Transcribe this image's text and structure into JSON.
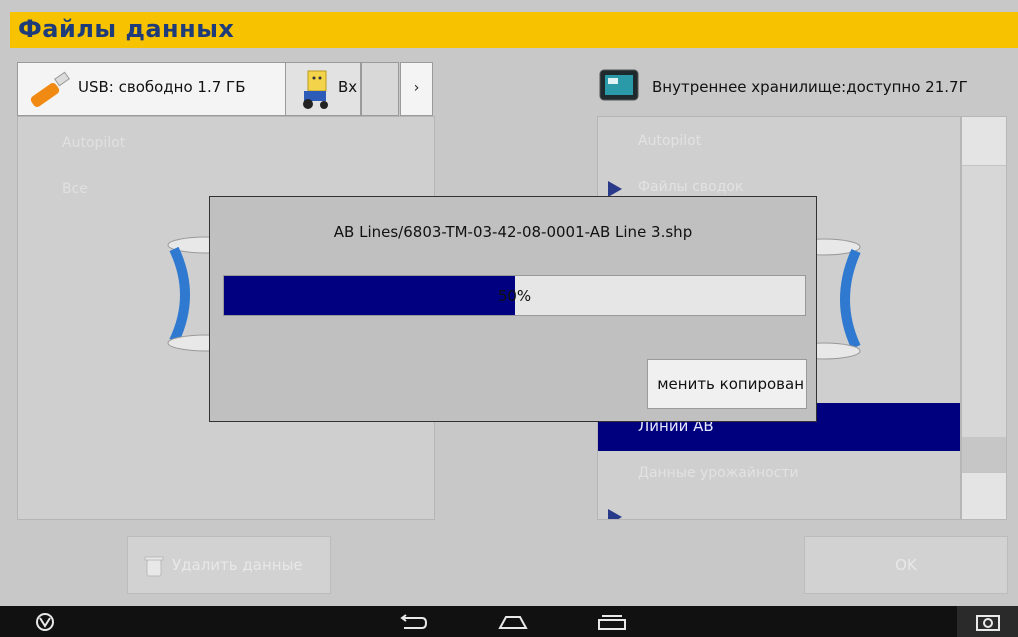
{
  "title": "Файлы данных",
  "colors": {
    "title_bar": "#f7c200",
    "title_text": "#1e3b7a",
    "selection": "#00007f",
    "progress_fill": "#000080"
  },
  "tabs": [
    {
      "label": "USB: свободно 1.7 ГБ",
      "icon": "usb-stick-icon"
    },
    {
      "label": "Вх",
      "icon": "inbox-tractor-icon"
    }
  ],
  "tab_scroll_right": "›",
  "right_header": {
    "label": "Внутреннее хранилище:доступно 21.7Г",
    "icon": "display-unit-icon"
  },
  "left_list": [
    "Autopilot",
    "Все"
  ],
  "right_list": {
    "items": [
      "Autopilot",
      "Файлы сводок",
      "Линии AB",
      "Данные урожайности"
    ],
    "selected": "Линии AB"
  },
  "dialog": {
    "path": "AB Lines/6803-TM-03-42-08-0001-AB Line 3.shp",
    "progress": 0.5,
    "progress_label": "50%",
    "cancel_label": "менить копирован"
  },
  "buttons": {
    "delete": "Удалить данные",
    "ok": "OK"
  },
  "navbar": {
    "left_icon": "power-icon",
    "back_icon": "back-icon",
    "home_icon": "home-icon",
    "recent_icon": "recent-apps-icon",
    "screenshot_icon": "camera-icon"
  }
}
